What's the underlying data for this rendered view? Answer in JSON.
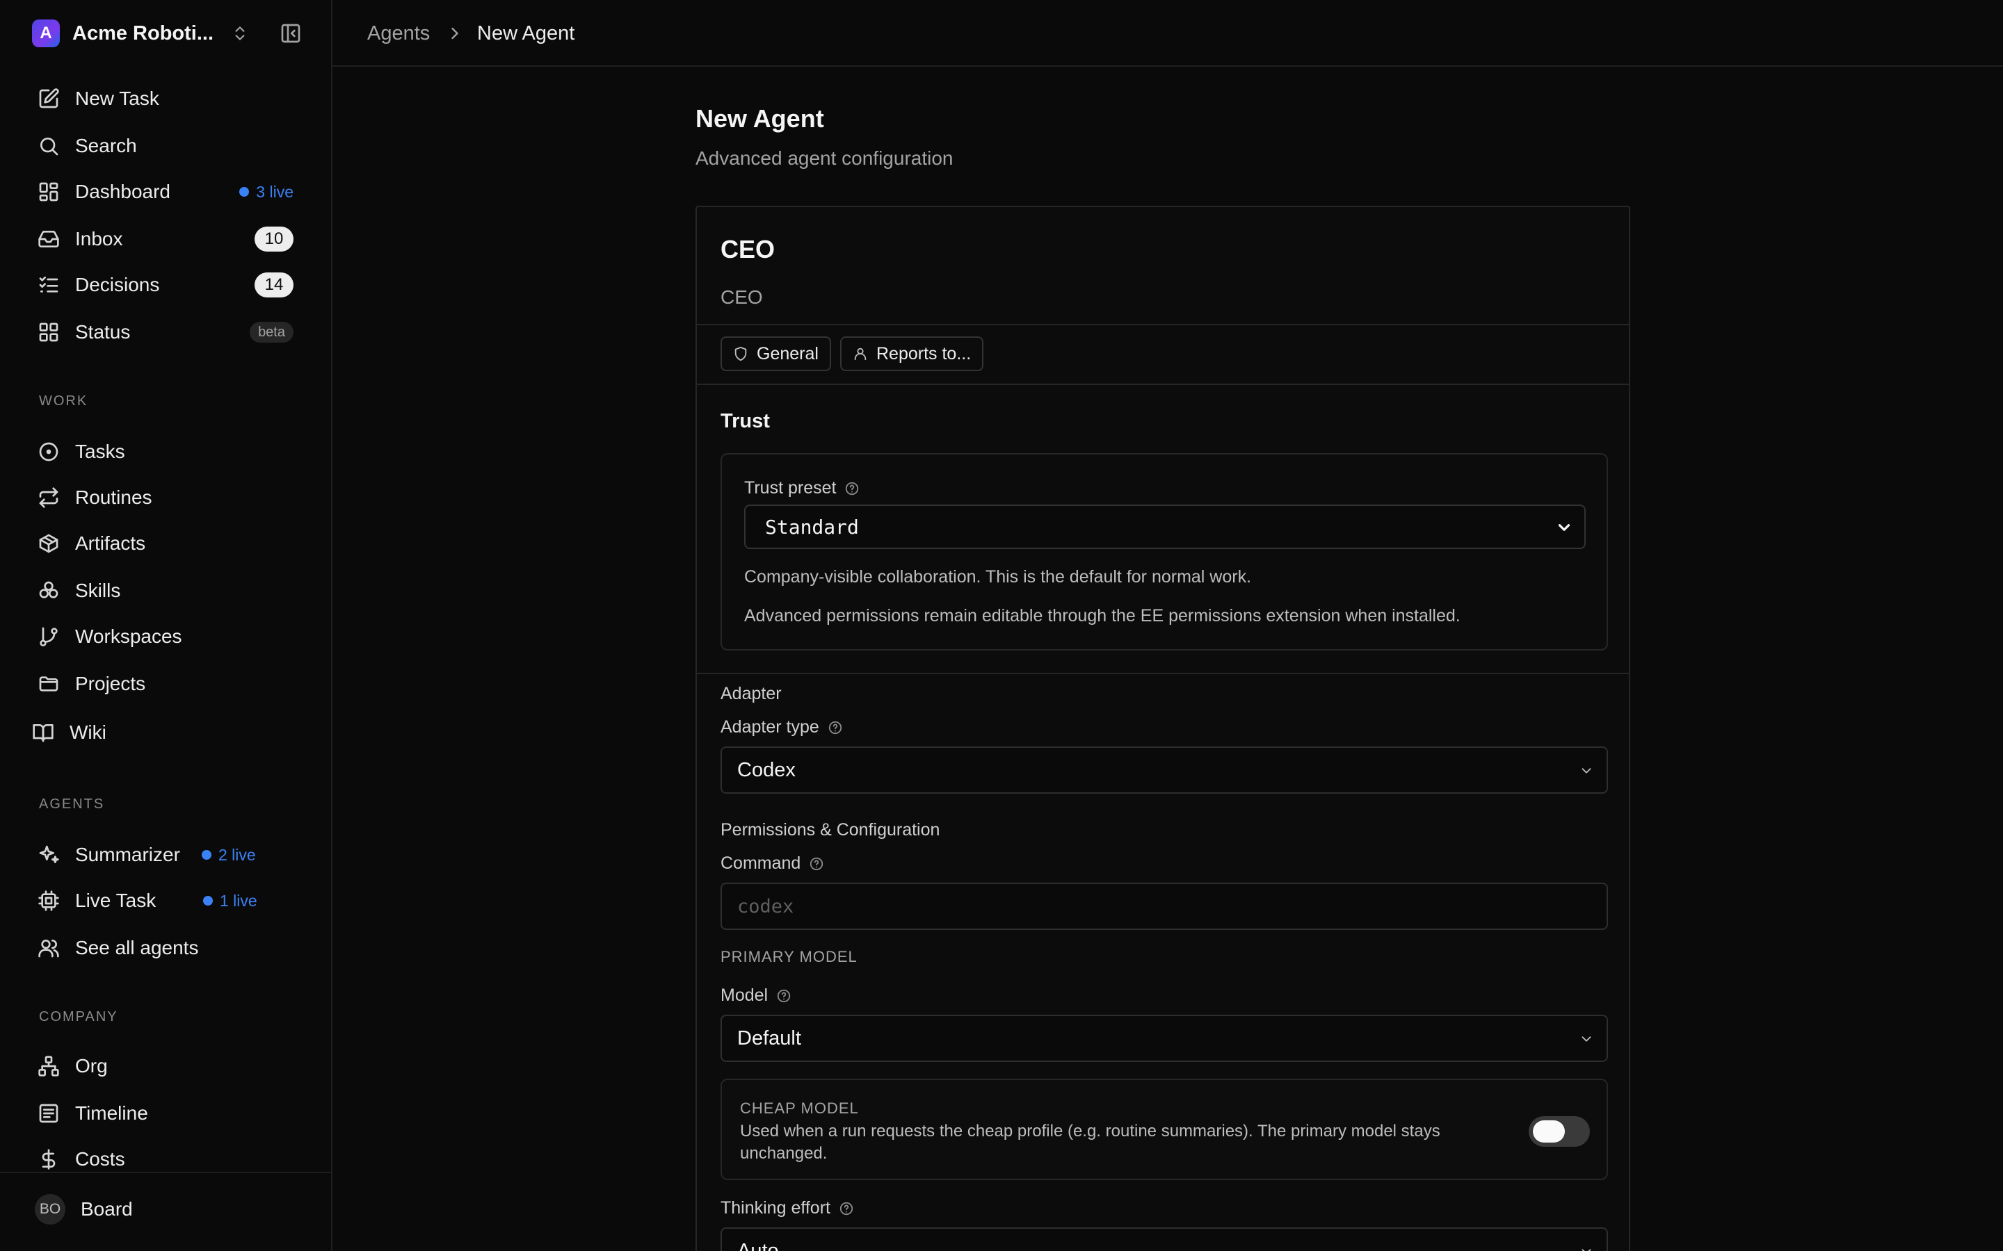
{
  "sidebar": {
    "company": {
      "initial": "A",
      "name": "Acme Roboti..."
    },
    "nav": [
      {
        "label": "New Task",
        "icon": "pencil-square-icon"
      },
      {
        "label": "Search",
        "icon": "search-icon"
      },
      {
        "label": "Dashboard",
        "icon": "dashboard-icon",
        "live": "3 live"
      },
      {
        "label": "Inbox",
        "icon": "inbox-icon",
        "count": "10"
      },
      {
        "label": "Decisions",
        "icon": "checklist-icon",
        "count": "14"
      },
      {
        "label": "Status",
        "icon": "grid-icon",
        "tag": "beta"
      }
    ],
    "work_label": "WORK",
    "work": [
      {
        "label": "Tasks",
        "icon": "circle-dot-icon"
      },
      {
        "label": "Routines",
        "icon": "repeat-icon"
      },
      {
        "label": "Artifacts",
        "icon": "package-icon"
      },
      {
        "label": "Skills",
        "icon": "circles-icon"
      },
      {
        "label": "Workspaces",
        "icon": "git-branch-icon"
      },
      {
        "label": "Projects",
        "icon": "folder-icon"
      },
      {
        "label": "Wiki",
        "icon": "book-icon"
      }
    ],
    "agents_label": "AGENTS",
    "agents": [
      {
        "label": "Summarizer",
        "icon": "sparkles-icon",
        "live": "2 live"
      },
      {
        "label": "Live Task",
        "icon": "cpu-icon",
        "live": "1 live"
      },
      {
        "label": "See all agents",
        "icon": "users-icon"
      }
    ],
    "company_label": "COMPANY",
    "company_items": [
      {
        "label": "Org",
        "icon": "org-chart-icon"
      },
      {
        "label": "Timeline",
        "icon": "timeline-icon"
      },
      {
        "label": "Costs",
        "icon": "dollar-icon"
      }
    ],
    "user": {
      "initials": "BO",
      "name": "Board"
    }
  },
  "breadcrumb": {
    "parent": "Agents",
    "separator": "›",
    "current": "New Agent"
  },
  "page": {
    "title": "New Agent",
    "subtitle": "Advanced agent configuration"
  },
  "agent": {
    "name": "CEO",
    "title": "CEO",
    "chips": [
      {
        "label": "General",
        "icon": "shield-icon"
      },
      {
        "label": "Reports to...",
        "icon": "user-icon"
      }
    ]
  },
  "trust": {
    "section_title": "Trust",
    "preset_label": "Trust preset",
    "preset_value": "Standard",
    "hint1": "Company-visible collaboration. This is the default for normal work.",
    "hint2": "Advanced permissions remain editable through the EE permissions extension when installed."
  },
  "adapter": {
    "section_title": "Adapter",
    "type_label": "Adapter type",
    "type_value": "Codex",
    "perm_title": "Permissions & Configuration",
    "command_label": "Command",
    "command_placeholder": "codex",
    "primary_model_caps": "PRIMARY MODEL",
    "model_label": "Model",
    "model_value": "Default",
    "cheap_caps": "CHEAP MODEL",
    "cheap_desc": "Used when a run requests the cheap profile (e.g. routine summaries). The primary model stays unchanged.",
    "cheap_enabled": false,
    "thinking_label": "Thinking effort",
    "thinking_value": "Auto"
  },
  "colors": {
    "accent_live": "#3b82f6",
    "background": "#0a0a0a",
    "border": "#262626"
  }
}
